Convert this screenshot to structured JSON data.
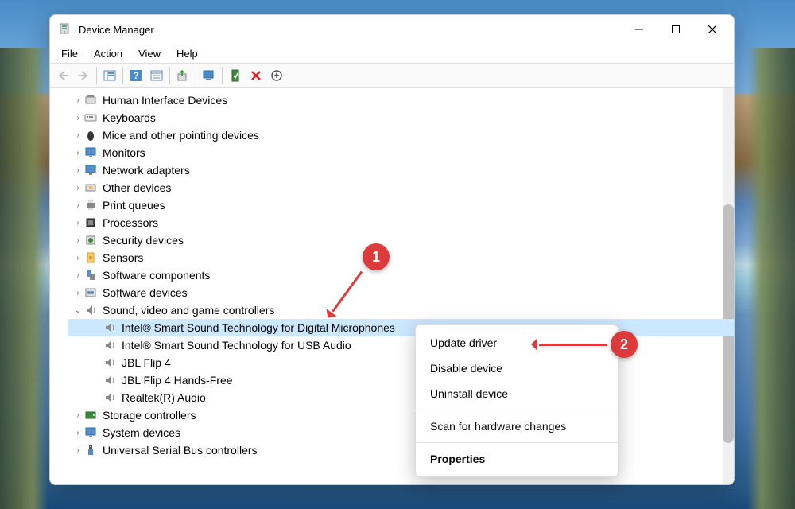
{
  "window": {
    "title": "Device Manager"
  },
  "menubar": [
    "File",
    "Action",
    "View",
    "Help"
  ],
  "tree": {
    "categories": [
      {
        "label": "Human Interface Devices",
        "icon": "hid",
        "expanded": false
      },
      {
        "label": "Keyboards",
        "icon": "keyboard",
        "expanded": false
      },
      {
        "label": "Mice and other pointing devices",
        "icon": "mouse",
        "expanded": false
      },
      {
        "label": "Monitors",
        "icon": "monitor",
        "expanded": false
      },
      {
        "label": "Network adapters",
        "icon": "network",
        "expanded": false
      },
      {
        "label": "Other devices",
        "icon": "other",
        "expanded": false
      },
      {
        "label": "Print queues",
        "icon": "printer",
        "expanded": false
      },
      {
        "label": "Processors",
        "icon": "cpu",
        "expanded": false
      },
      {
        "label": "Security devices",
        "icon": "security",
        "expanded": false
      },
      {
        "label": "Sensors",
        "icon": "sensor",
        "expanded": false
      },
      {
        "label": "Software components",
        "icon": "swcomp",
        "expanded": false
      },
      {
        "label": "Software devices",
        "icon": "swdev",
        "expanded": false
      },
      {
        "label": "Sound, video and game controllers",
        "icon": "sound",
        "expanded": true,
        "children": [
          {
            "label": "Intel® Smart Sound Technology for Digital Microphones",
            "selected": true
          },
          {
            "label": "Intel® Smart Sound Technology for USB Audio",
            "selected": false
          },
          {
            "label": "JBL Flip 4",
            "selected": false
          },
          {
            "label": "JBL Flip 4 Hands-Free",
            "selected": false
          },
          {
            "label": "Realtek(R) Audio",
            "selected": false
          }
        ]
      },
      {
        "label": "Storage controllers",
        "icon": "storage",
        "expanded": false
      },
      {
        "label": "System devices",
        "icon": "system",
        "expanded": false
      },
      {
        "label": "Universal Serial Bus controllers",
        "icon": "usb",
        "expanded": false
      }
    ]
  },
  "context_menu": {
    "items": [
      {
        "label": "Update driver",
        "type": "item"
      },
      {
        "label": "Disable device",
        "type": "item"
      },
      {
        "label": "Uninstall device",
        "type": "item"
      },
      {
        "type": "sep"
      },
      {
        "label": "Scan for hardware changes",
        "type": "item"
      },
      {
        "type": "sep"
      },
      {
        "label": "Properties",
        "type": "bold"
      }
    ]
  },
  "callouts": {
    "one": "1",
    "two": "2"
  }
}
